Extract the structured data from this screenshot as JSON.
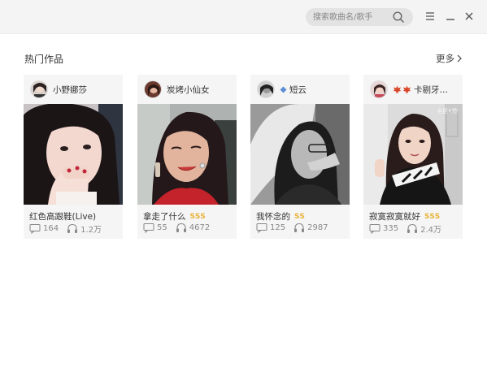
{
  "search": {
    "placeholder": "搜索歌曲名/歌手"
  },
  "section": {
    "title": "热门作品",
    "more": "更多"
  },
  "cards": [
    {
      "user": "小野娜莎",
      "song": "红色高跟鞋(Live)",
      "badge": "",
      "comments": "164",
      "plays": "1.2万"
    },
    {
      "user": "炭烤小仙女",
      "song": "拿走了什么",
      "badge": "SSS",
      "comments": "55",
      "plays": "4672"
    },
    {
      "user": "短云",
      "song": "我怀念的",
      "badge": "SS",
      "comments": "125",
      "plays": "2987"
    },
    {
      "user": "卡剔牙…",
      "song": "寂寞寂寞就好",
      "badge": "SSS",
      "comments": "335",
      "plays": "2.4万",
      "watermark": "全民K歌"
    }
  ],
  "colors": {
    "badge": "#e9b43a",
    "card_bg": "#f5f5f5",
    "titlebar_bg": "#f4f4f4"
  }
}
